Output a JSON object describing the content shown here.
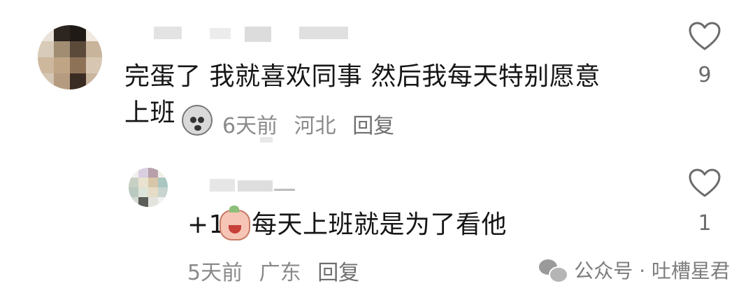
{
  "comments": [
    {
      "text_line1": "完蛋了 我就喜欢同事 然后我每天特别愿意",
      "text_line2": "上班",
      "emoji": "shocked-face-emoji",
      "time": "6天前",
      "location": "河北",
      "reply_label": "回复",
      "likes": "9"
    }
  ],
  "replies": [
    {
      "prefix": "+1",
      "emoji": "crying-face-emoji",
      "text": "每天上班就是为了看他",
      "time": "5天前",
      "location": "广东",
      "reply_label": "回复",
      "likes": "1"
    }
  ],
  "watermark": {
    "icon": "wechat-icon",
    "text": "公众号 · 吐槽星君"
  },
  "colors": {
    "text": "#161616",
    "meta": "#8a8a8a",
    "icon": "#6b6b6b"
  }
}
